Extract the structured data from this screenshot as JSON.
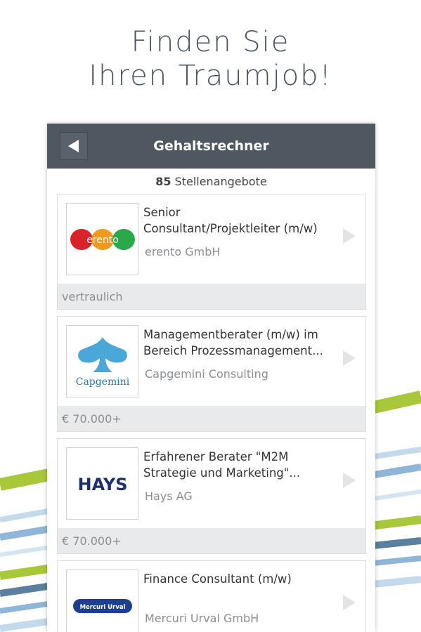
{
  "headline": {
    "line1": "Finden Sie",
    "line2": "Ihren Traumjob!"
  },
  "appbar": {
    "title": "Gehaltsrechner",
    "back_icon": "back-arrow-icon"
  },
  "listing": {
    "count": "85",
    "count_label": "Stellenangebote"
  },
  "jobs": [
    {
      "title_line1": "Senior",
      "title_line2": "Consultant/Projektleiter (m/w)",
      "company": "erento GmbH",
      "salary": "vertraulich",
      "logo": {
        "name": "erento-logo",
        "text": "erento",
        "colors": [
          "#d8232a",
          "#f29a1f",
          "#2aa84a"
        ]
      }
    },
    {
      "title_line1": "Managementberater (m/w) im",
      "title_line2": "Bereich Prozessmanagement...",
      "company": "Capgemini Consulting",
      "salary": "€ 70.000+",
      "logo": {
        "name": "capgemini-logo",
        "text": "Capgemini",
        "color": "#1a7ab5"
      }
    },
    {
      "title_line1": "Erfahrener Berater \"M2M",
      "title_line2": "Strategie und Marketing\"...",
      "company": "Hays AG",
      "salary": "€ 70.000+",
      "logo": {
        "name": "hays-logo",
        "text": "HAYS",
        "color": "#1f2f6e"
      }
    },
    {
      "title_line1": "Finance Consultant (m/w)",
      "title_line2": "",
      "company": "Mercuri Urval GmbH",
      "salary": "",
      "logo": {
        "name": "mercuri-urval-logo",
        "text": "Mercuri Urval",
        "color": "#1d3f8f"
      }
    }
  ],
  "colors": {
    "appbar": "#4f5861",
    "stripe_green": "#a8c83a",
    "stripe_blue": "#8fb6d8",
    "stripe_dark": "#5b7f9e"
  }
}
